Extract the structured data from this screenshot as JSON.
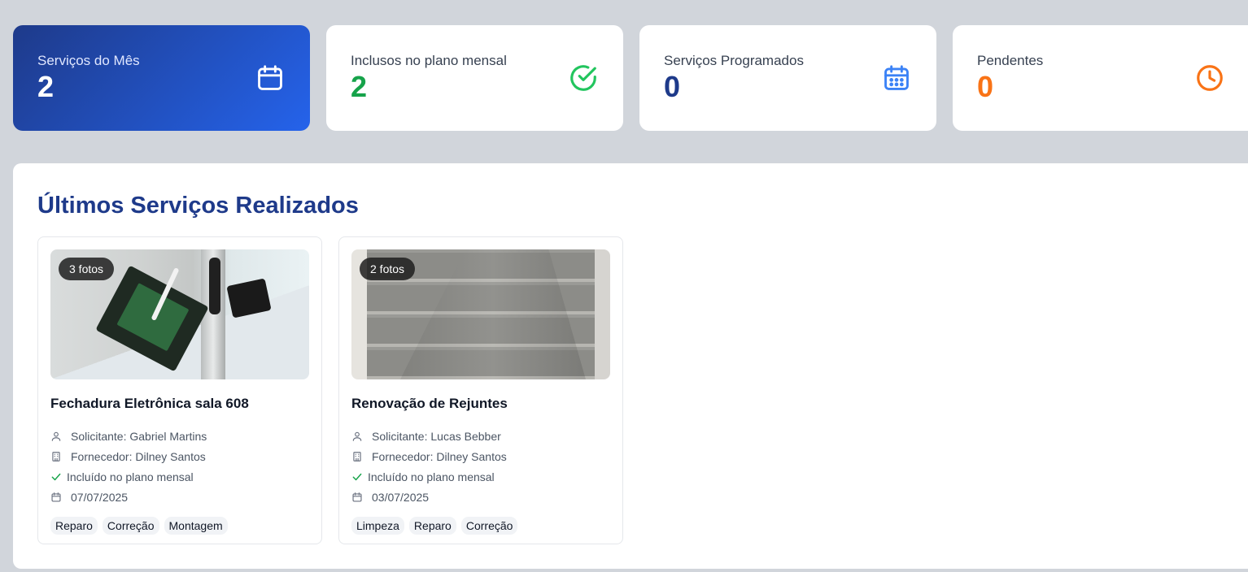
{
  "stats": [
    {
      "label": "Serviços do Mês",
      "value": "2",
      "icon": "calendar-icon"
    },
    {
      "label": "Inclusos no plano mensal",
      "value": "2",
      "icon": "check-circle-icon",
      "color": "#16a34a"
    },
    {
      "label": "Serviços Programados",
      "value": "0",
      "icon": "calendar-grid-icon",
      "color": "#1e3a8a"
    },
    {
      "label": "Pendentes",
      "value": "0",
      "icon": "clock-icon",
      "color": "#f97316"
    }
  ],
  "section": {
    "title": "Últimos Serviços Realizados"
  },
  "services": [
    {
      "photos": "3 fotos",
      "title": "Fechadura Eletrônica sala 608",
      "requester": "Solicitante: Gabriel Martins",
      "supplier": "Fornecedor: Dilney Santos",
      "plan": "Incluído no plano mensal",
      "date": "07/07/2025",
      "tags": [
        "Reparo",
        "Correção",
        "Montagem"
      ]
    },
    {
      "photos": "2 fotos",
      "title": "Renovação de Rejuntes",
      "requester": "Solicitante: Lucas Bebber",
      "supplier": "Fornecedor: Dilney Santos",
      "plan": "Incluído no plano mensal",
      "date": "03/07/2025",
      "tags": [
        "Limpeza",
        "Reparo",
        "Correção"
      ]
    }
  ],
  "colors": {
    "accent": "#1e3a8a",
    "primary_gradient_start": "#1e3a8a",
    "primary_gradient_end": "#2563eb",
    "success": "#16a34a",
    "warning": "#f97316",
    "info_icon": "#3b82f6"
  }
}
